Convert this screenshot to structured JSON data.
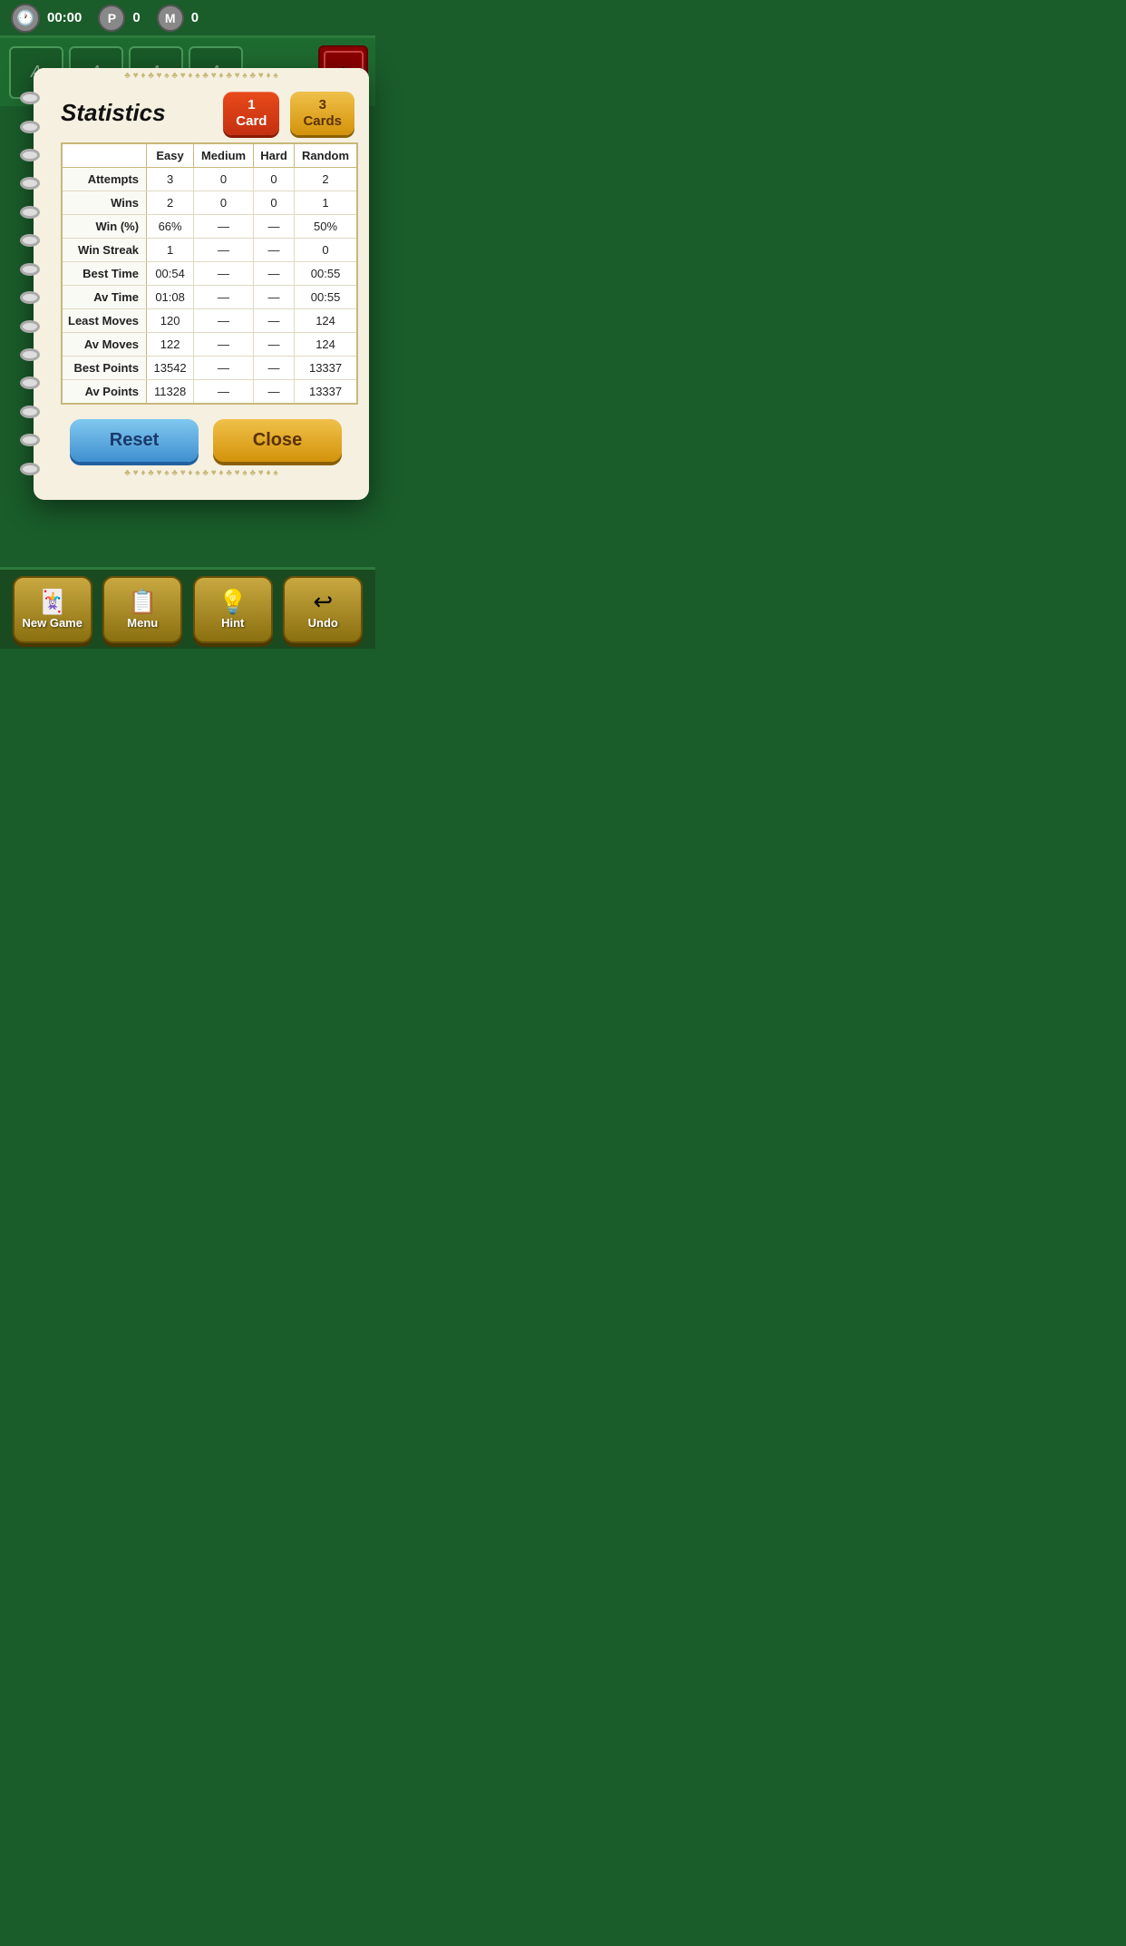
{
  "topbar": {
    "timer": "00:00",
    "p_label": "P",
    "p_score": "0",
    "m_label": "M",
    "m_score": "0"
  },
  "card_area": {
    "placeholders": [
      "A",
      "A",
      "A",
      "A"
    ]
  },
  "modal": {
    "title": "Statistics",
    "tab1_line1": "1",
    "tab1_line2": "Card",
    "tab2_line1": "3",
    "tab2_line2": "Cards",
    "columns": [
      "Easy",
      "Medium",
      "Hard",
      "Random"
    ],
    "rows": [
      {
        "label": "Attempts",
        "easy": "3",
        "medium": "0",
        "hard": "0",
        "random": "2"
      },
      {
        "label": "Wins",
        "easy": "2",
        "medium": "0",
        "hard": "0",
        "random": "1"
      },
      {
        "label": "Win (%)",
        "easy": "66%",
        "medium": "—",
        "hard": "—",
        "random": "50%"
      },
      {
        "label": "Win Streak",
        "easy": "1",
        "medium": "—",
        "hard": "—",
        "random": "0"
      },
      {
        "label": "Best Time",
        "easy": "00:54",
        "medium": "—",
        "hard": "—",
        "random": "00:55"
      },
      {
        "label": "Av Time",
        "easy": "01:08",
        "medium": "—",
        "hard": "—",
        "random": "00:55"
      },
      {
        "label": "Least Moves",
        "easy": "120",
        "medium": "—",
        "hard": "—",
        "random": "124"
      },
      {
        "label": "Av Moves",
        "easy": "122",
        "medium": "—",
        "hard": "—",
        "random": "124"
      },
      {
        "label": "Best Points",
        "easy": "13542",
        "medium": "—",
        "hard": "—",
        "random": "13337"
      },
      {
        "label": "Av Points",
        "easy": "11328",
        "medium": "—",
        "hard": "—",
        "random": "13337"
      }
    ],
    "reset_label": "Reset",
    "close_label": "Close"
  },
  "bottomnav": {
    "new_game": "New Game",
    "menu": "Menu",
    "hint": "Hint",
    "undo": "Undo"
  },
  "suits_border": "♣ ♥ ♦ ♣ ♥ ♠ ♣ ♥ ♦ ♠ ♣ ♥ ♦ ♣ ♥ ♠ ♣ ♥ ♦ ♠"
}
